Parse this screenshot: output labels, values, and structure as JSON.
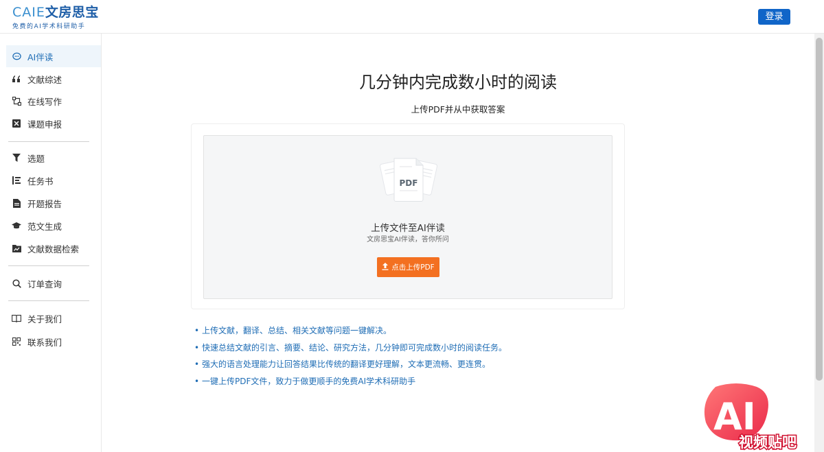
{
  "header": {
    "logo_en": "CAIE",
    "logo_cn": "文房思宝",
    "logo_tagline": "免费的AI学术科研助手",
    "login_label": "登录"
  },
  "sidebar": {
    "groups": [
      [
        {
          "label": "AI伴读",
          "icon": "chat-bubble-icon",
          "active": true
        },
        {
          "label": "文献综述",
          "icon": "quote-icon"
        },
        {
          "label": "在线写作",
          "icon": "nodes-icon"
        },
        {
          "label": "课题申报",
          "icon": "x-box-icon"
        }
      ],
      [
        {
          "label": "选题",
          "icon": "filter-icon"
        },
        {
          "label": "任务书",
          "icon": "list-icon"
        },
        {
          "label": "开题报告",
          "icon": "document-icon"
        },
        {
          "label": "范文生成",
          "icon": "graduation-cap-icon"
        },
        {
          "label": "文献数据检索",
          "icon": "folder-chart-icon"
        }
      ],
      [
        {
          "label": "订单查询",
          "icon": "search-icon"
        }
      ],
      [
        {
          "label": "关于我们",
          "icon": "book-icon"
        },
        {
          "label": "联系我们",
          "icon": "qr-code-icon"
        }
      ]
    ]
  },
  "main": {
    "title": "几分钟内完成数小时的阅读",
    "subtitle": "上传PDF并从中获取答案",
    "upload": {
      "badge": "PDF",
      "title": "上传文件至AI伴读",
      "description": "文房思宝AI伴读，答你所问",
      "button_label": "点击上传PDF"
    },
    "features": [
      "上传文献，翻译、总结、相关文献等问题一键解决。",
      "快速总结文献的引言、摘要、结论、研究方法，几分钟即可完成数小时的阅读任务。",
      "强大的语言处理能力让回答结果比传统的翻译更好理解，文本更流畅、更连贯。",
      "一键上传PDF文件，致力于做更顺手的免费AI学术科研助手"
    ]
  },
  "watermark": {
    "big_text": "AI",
    "small_text": "视频贴吧"
  },
  "colors": {
    "accent_blue": "#1065c8",
    "link_blue": "#1f6db5",
    "upload_orange": "#f37021",
    "active_bg": "#eef5fb"
  }
}
